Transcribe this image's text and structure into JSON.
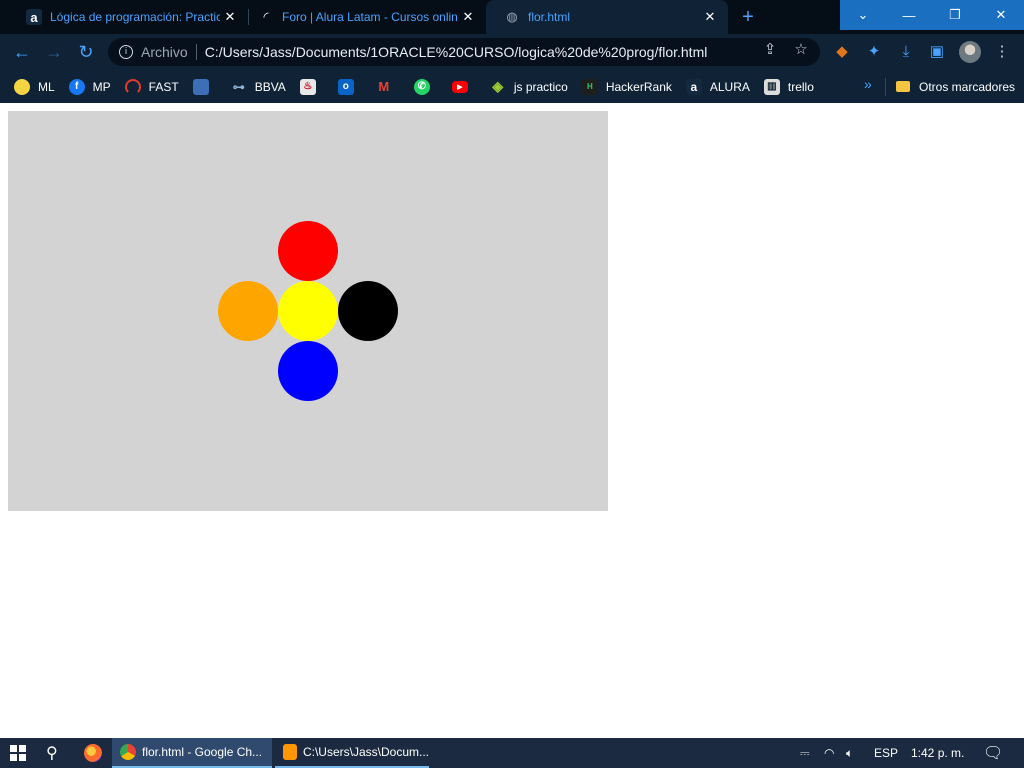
{
  "tabs": [
    {
      "title": "Lógica de programación: Practica",
      "favicon": "alura-icon",
      "active": false
    },
    {
      "title": "Foro | Alura Latam - Cursos online",
      "favicon": "loading-icon",
      "active": false
    },
    {
      "title": "flor.html",
      "favicon": "globe-icon",
      "active": true
    }
  ],
  "window_controls": {
    "tab_search": "⌄",
    "minimize": "—",
    "restore": "❐",
    "close": "✕"
  },
  "toolbar": {
    "scheme": "Archivo",
    "url": "C:/Users/Jass/Documents/1ORACLE%20CURSO/logica%20de%20prog/flor.html"
  },
  "bookmarks": [
    {
      "label": "ML",
      "icon": "mercadolibre-icon",
      "color": "#f5d442"
    },
    {
      "label": "MP",
      "icon": "facebook-icon",
      "color": "#1877f2"
    },
    {
      "label": "FAST",
      "icon": "speed-icon",
      "color": "#e23b2e"
    },
    {
      "label": "",
      "icon": "app-icon",
      "color": "#3d6fb6"
    },
    {
      "label": "BBVA",
      "icon": "bbva-icon",
      "color": "#8fb4d9"
    },
    {
      "label": "",
      "icon": "santander-icon",
      "color": "#e8e8e8"
    },
    {
      "label": "",
      "icon": "outlook-icon",
      "color": "#0a64c8"
    },
    {
      "label": "",
      "icon": "gmail-icon",
      "color": "#ea4335"
    },
    {
      "label": "",
      "icon": "whatsapp-icon",
      "color": "#25d366"
    },
    {
      "label": "",
      "icon": "youtube-icon",
      "color": "#ff0000"
    },
    {
      "label": "js practico",
      "icon": "js-practico-icon",
      "color": "#9acd32"
    },
    {
      "label": "HackerRank",
      "icon": "hackerrank-icon",
      "color": "#1e1e1e"
    },
    {
      "label": "ALURA",
      "icon": "alura-icon",
      "color": "#0b1a2b"
    },
    {
      "label": "trello",
      "icon": "trello-icon",
      "color": "#dcdcdc"
    }
  ],
  "other_bookmarks": "Otros marcadores",
  "canvas": {
    "background": "#d3d3d3",
    "circles": [
      {
        "name": "red-circle",
        "color": "#ff0000"
      },
      {
        "name": "orange-circle",
        "color": "#ffa500"
      },
      {
        "name": "yellow-circle",
        "color": "#ffff00"
      },
      {
        "name": "black-circle",
        "color": "#000000"
      },
      {
        "name": "blue-circle",
        "color": "#0000ff"
      }
    ]
  },
  "taskbar": {
    "apps": [
      {
        "label": "flor.html - Google Ch...",
        "icon": "chrome-icon"
      },
      {
        "label": "C:\\Users\\Jass\\Docum...",
        "icon": "sublime-icon"
      }
    ],
    "language": "ESP",
    "time": "1:42 p. m."
  }
}
